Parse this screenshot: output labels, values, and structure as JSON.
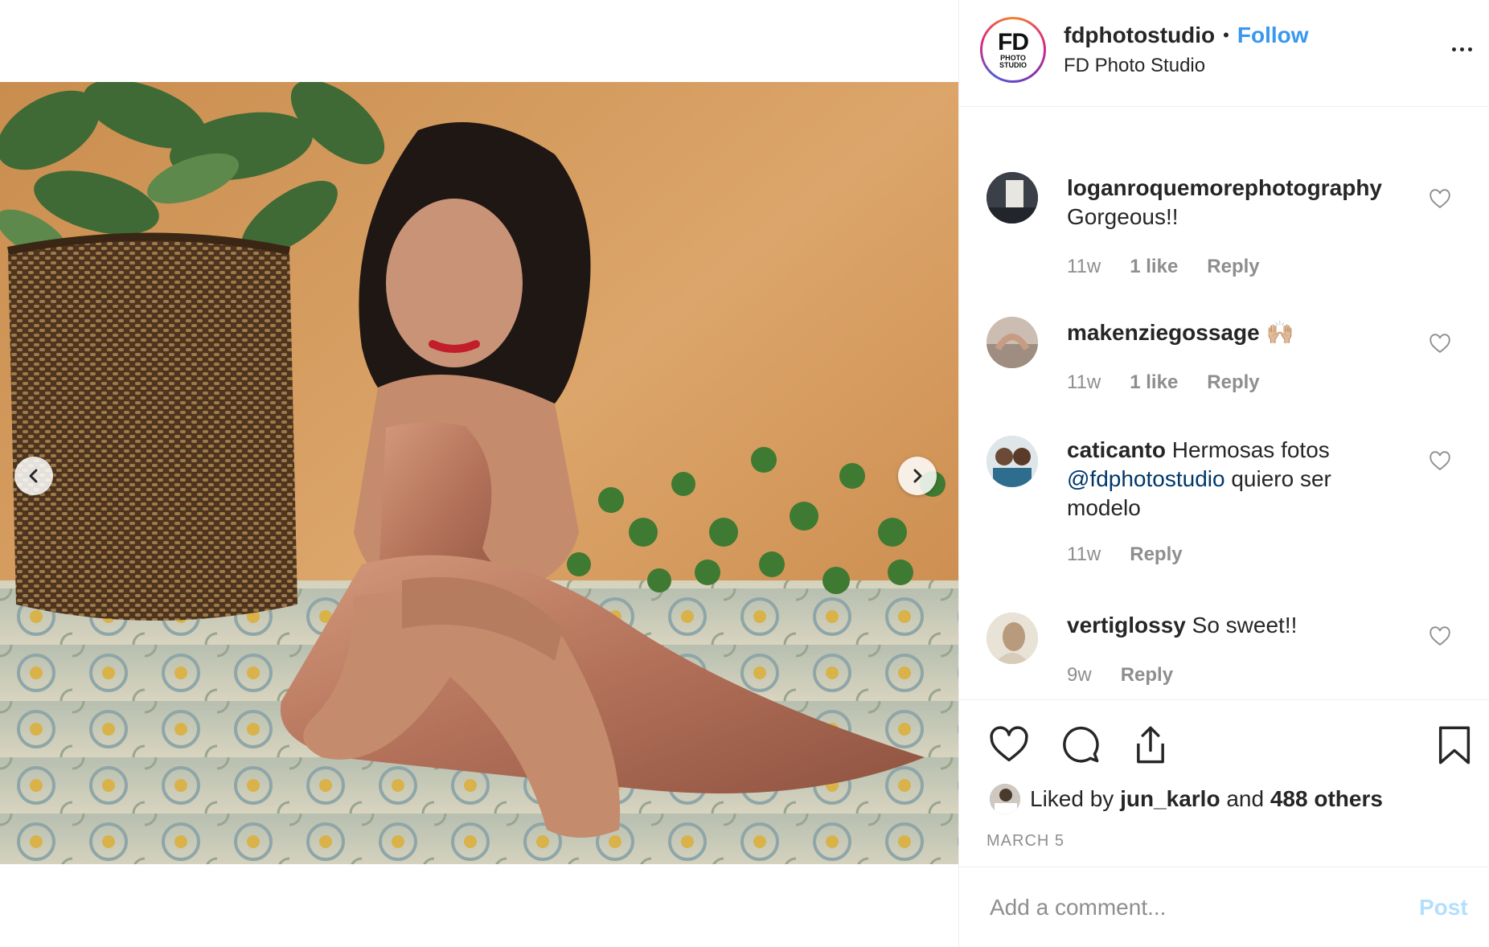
{
  "post": {
    "account": {
      "handle": "fdphotostudio",
      "full_name": "FD Photo Studio",
      "follow_label": "Follow",
      "separator": "•",
      "logo_text": "FD",
      "logo_sub_1": "PHOTO",
      "logo_sub_2": "STUDIO"
    },
    "comments": [
      {
        "user": "loganroquemorephotography",
        "text": "Gorgeous!!",
        "time": "11w",
        "likes": "1 like",
        "reply": "Reply"
      },
      {
        "user": "makenziegossage",
        "text": "🙌🏼",
        "time": "11w",
        "likes": "1 like",
        "reply": "Reply"
      },
      {
        "user": "caticanto",
        "text_before": "Hermosas fotos",
        "mention": "@fdphotostudio",
        "text_after": "quiero ser modelo",
        "time": "11w",
        "reply": "Reply"
      },
      {
        "user": "vertiglossy",
        "text": "So sweet!!",
        "time": "9w",
        "reply": "Reply"
      }
    ],
    "likes": {
      "prefix": "Liked by",
      "liker": "jun_karlo",
      "joiner": "and",
      "others": "488 others"
    },
    "date": "MARCH 5",
    "comment_box": {
      "placeholder": "Add a comment...",
      "post_label": "Post"
    }
  },
  "colors": {
    "link_blue": "#3897f0",
    "mention_blue": "#00376b",
    "muted": "#8e8e8e",
    "post_disabled": "#b2dffc",
    "border": "#efefef"
  },
  "icons": {
    "carousel_prev": "chevron-left-icon",
    "carousel_next": "chevron-right-icon",
    "like": "heart-icon",
    "comment": "comment-bubble-icon",
    "share": "share-icon",
    "save": "bookmark-icon",
    "more": "more-dots-icon"
  }
}
